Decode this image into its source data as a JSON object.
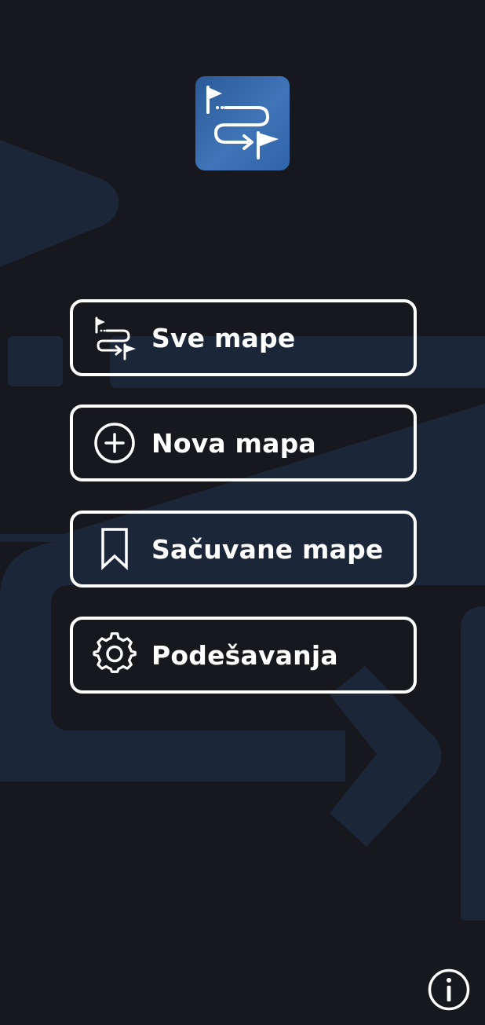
{
  "app": {
    "logo_icon": "route-flags-icon",
    "logo_colors": [
      "#2b5a97",
      "#3f74b8"
    ]
  },
  "menu": {
    "items": [
      {
        "label": "Sve mape",
        "icon": "route-flags-icon"
      },
      {
        "label": "Nova mapa",
        "icon": "plus-circle-icon"
      },
      {
        "label": "Sačuvane mape",
        "icon": "bookmark-icon"
      },
      {
        "label": "Podešavanja",
        "icon": "gear-icon"
      }
    ]
  },
  "footer": {
    "info_icon": "info-icon"
  },
  "colors": {
    "background": "#17181d",
    "decoration": "#1b2638",
    "button_border": "#ffffff",
    "text": "#ffffff"
  }
}
